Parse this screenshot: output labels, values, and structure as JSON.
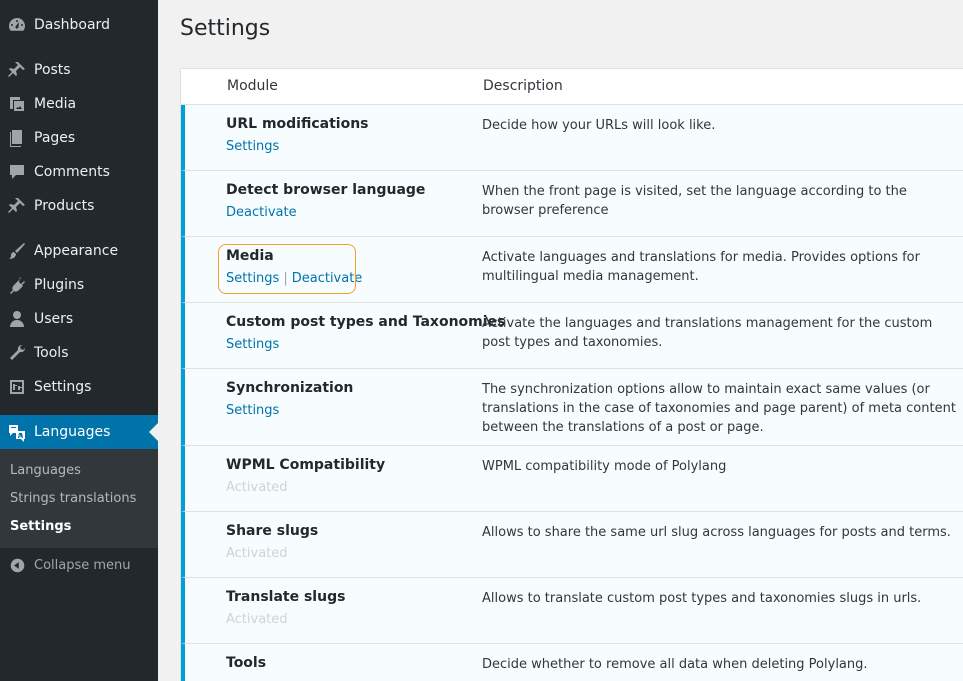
{
  "sidebar": {
    "items": [
      {
        "label": "Dashboard",
        "icon": "dashboard-icon"
      },
      {
        "label": "Posts",
        "icon": "pin-icon"
      },
      {
        "label": "Media",
        "icon": "media-icon"
      },
      {
        "label": "Pages",
        "icon": "pages-icon"
      },
      {
        "label": "Comments",
        "icon": "comment-icon"
      },
      {
        "label": "Products",
        "icon": "pin-icon"
      },
      {
        "label": "Appearance",
        "icon": "brush-icon"
      },
      {
        "label": "Plugins",
        "icon": "plug-icon"
      },
      {
        "label": "Users",
        "icon": "user-icon"
      },
      {
        "label": "Tools",
        "icon": "wrench-icon"
      },
      {
        "label": "Settings",
        "icon": "sliders-icon"
      },
      {
        "label": "Languages",
        "icon": "translate-icon"
      }
    ],
    "submenu": [
      "Languages",
      "Strings translations",
      "Settings"
    ],
    "collapse_label": "Collapse menu"
  },
  "page": {
    "title": "Settings"
  },
  "table": {
    "headers": {
      "module": "Module",
      "description": "Description"
    },
    "rows": [
      {
        "name": "URL modifications",
        "actions": [
          "Settings"
        ],
        "description": "Decide how your URLs will look like."
      },
      {
        "name": "Detect browser language",
        "actions": [
          "Deactivate"
        ],
        "description": "When the front page is visited, set the language according to the browser preference"
      },
      {
        "name": "Media",
        "actions": [
          "Settings",
          "Deactivate"
        ],
        "description": "Activate languages and translations for media. Provides options for multilingual media management."
      },
      {
        "name": "Custom post types and Taxonomies",
        "actions": [
          "Settings"
        ],
        "description": "Activate the languages and translations management for the custom post types and taxonomies."
      },
      {
        "name": "Synchronization",
        "actions": [
          "Settings"
        ],
        "description": "The synchronization options allow to maintain exact same values (or translations in the case of taxonomies and page parent) of meta content between the translations of a post or page."
      },
      {
        "name": "WPML Compatibility",
        "status": "Activated",
        "description": "WPML compatibility mode of Polylang"
      },
      {
        "name": "Share slugs",
        "status": "Activated",
        "description": "Allows to share the same url slug across languages for posts and terms."
      },
      {
        "name": "Translate slugs",
        "status": "Activated",
        "description": "Allows to translate custom post types and taxonomies slugs in urls."
      },
      {
        "name": "Tools",
        "description": "Decide whether to remove all data when deleting Polylang."
      }
    ]
  },
  "colors": {
    "sidebar_bg": "#23282d",
    "active_bg": "#0073aa",
    "link": "#0073aa",
    "active_border": "#00a0d2",
    "highlight": "#f0a030"
  }
}
